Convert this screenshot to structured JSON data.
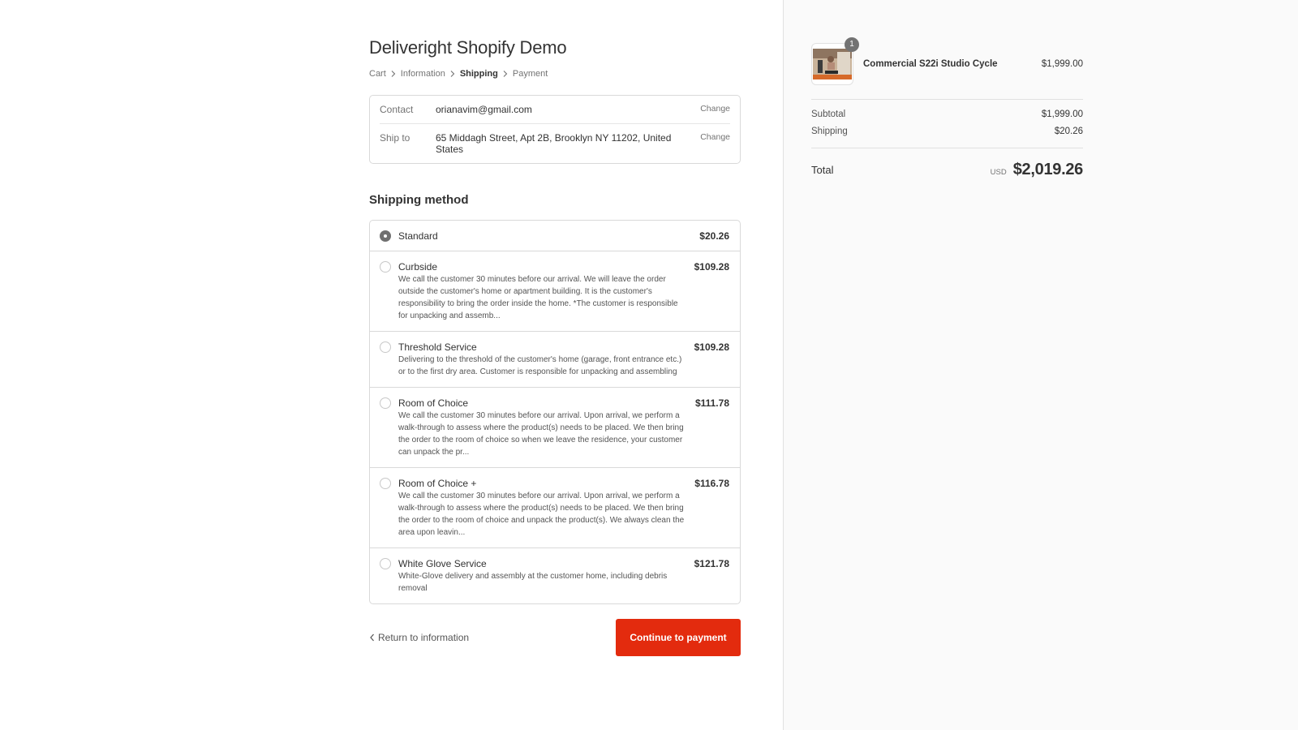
{
  "store": {
    "title": "Deliveright Shopify Demo"
  },
  "breadcrumb": [
    {
      "label": "Cart",
      "active": false
    },
    {
      "label": "Information",
      "active": false
    },
    {
      "label": "Shipping",
      "active": true
    },
    {
      "label": "Payment",
      "active": false
    }
  ],
  "review": {
    "contact_label": "Contact",
    "contact_value": "orianavim@gmail.com",
    "ship_label": "Ship to",
    "ship_value": "65 Middagh Street, Apt 2B, Brooklyn NY 11202, United States",
    "change_label": "Change"
  },
  "shipping": {
    "title": "Shipping method",
    "methods": [
      {
        "name": "Standard",
        "price": "$20.26",
        "description": "",
        "selected": true
      },
      {
        "name": "Curbside",
        "price": "$109.28",
        "description": "We call the customer 30 minutes before our arrival. We will leave the order outside the customer's home or apartment building. It is the customer's responsibility to bring the order inside the home. *The customer is responsible for unpacking and assemb...",
        "selected": false
      },
      {
        "name": "Threshold Service",
        "price": "$109.28",
        "description": "Delivering to the threshold of the customer's home (garage, front entrance etc.) or to the first dry area. Customer is responsible for unpacking and assembling",
        "selected": false
      },
      {
        "name": "Room of Choice",
        "price": "$111.78",
        "description": "We call the customer 30 minutes before our arrival. Upon arrival, we perform a walk-through to assess where the product(s) needs to be placed. We then bring the order to the room of choice so when we leave the residence, your customer can unpack the pr...",
        "selected": false
      },
      {
        "name": "Room of Choice +",
        "price": "$116.78",
        "description": "We call the customer 30 minutes before our arrival. Upon arrival, we perform a walk-through to assess where the product(s) needs to be placed. We then bring the order to the room of choice and unpack the product(s). We always clean the area upon leavin...",
        "selected": false
      },
      {
        "name": "White Glove Service",
        "price": "$121.78",
        "description": "White-Glove delivery and assembly at the customer home, including debris removal",
        "selected": false
      }
    ]
  },
  "actions": {
    "return_label": "Return to information",
    "continue_label": "Continue to payment"
  },
  "summary": {
    "product": {
      "name": "Commercial S22i Studio Cycle",
      "price": "$1,999.00",
      "quantity": "1"
    },
    "subtotal_label": "Subtotal",
    "subtotal_value": "$1,999.00",
    "shipping_label": "Shipping",
    "shipping_value": "$20.26",
    "total_label": "Total",
    "currency": "USD",
    "total_value": "$2,019.26"
  },
  "colors": {
    "accent": "#e32b0e",
    "sidebar_bg": "#fafafa"
  }
}
